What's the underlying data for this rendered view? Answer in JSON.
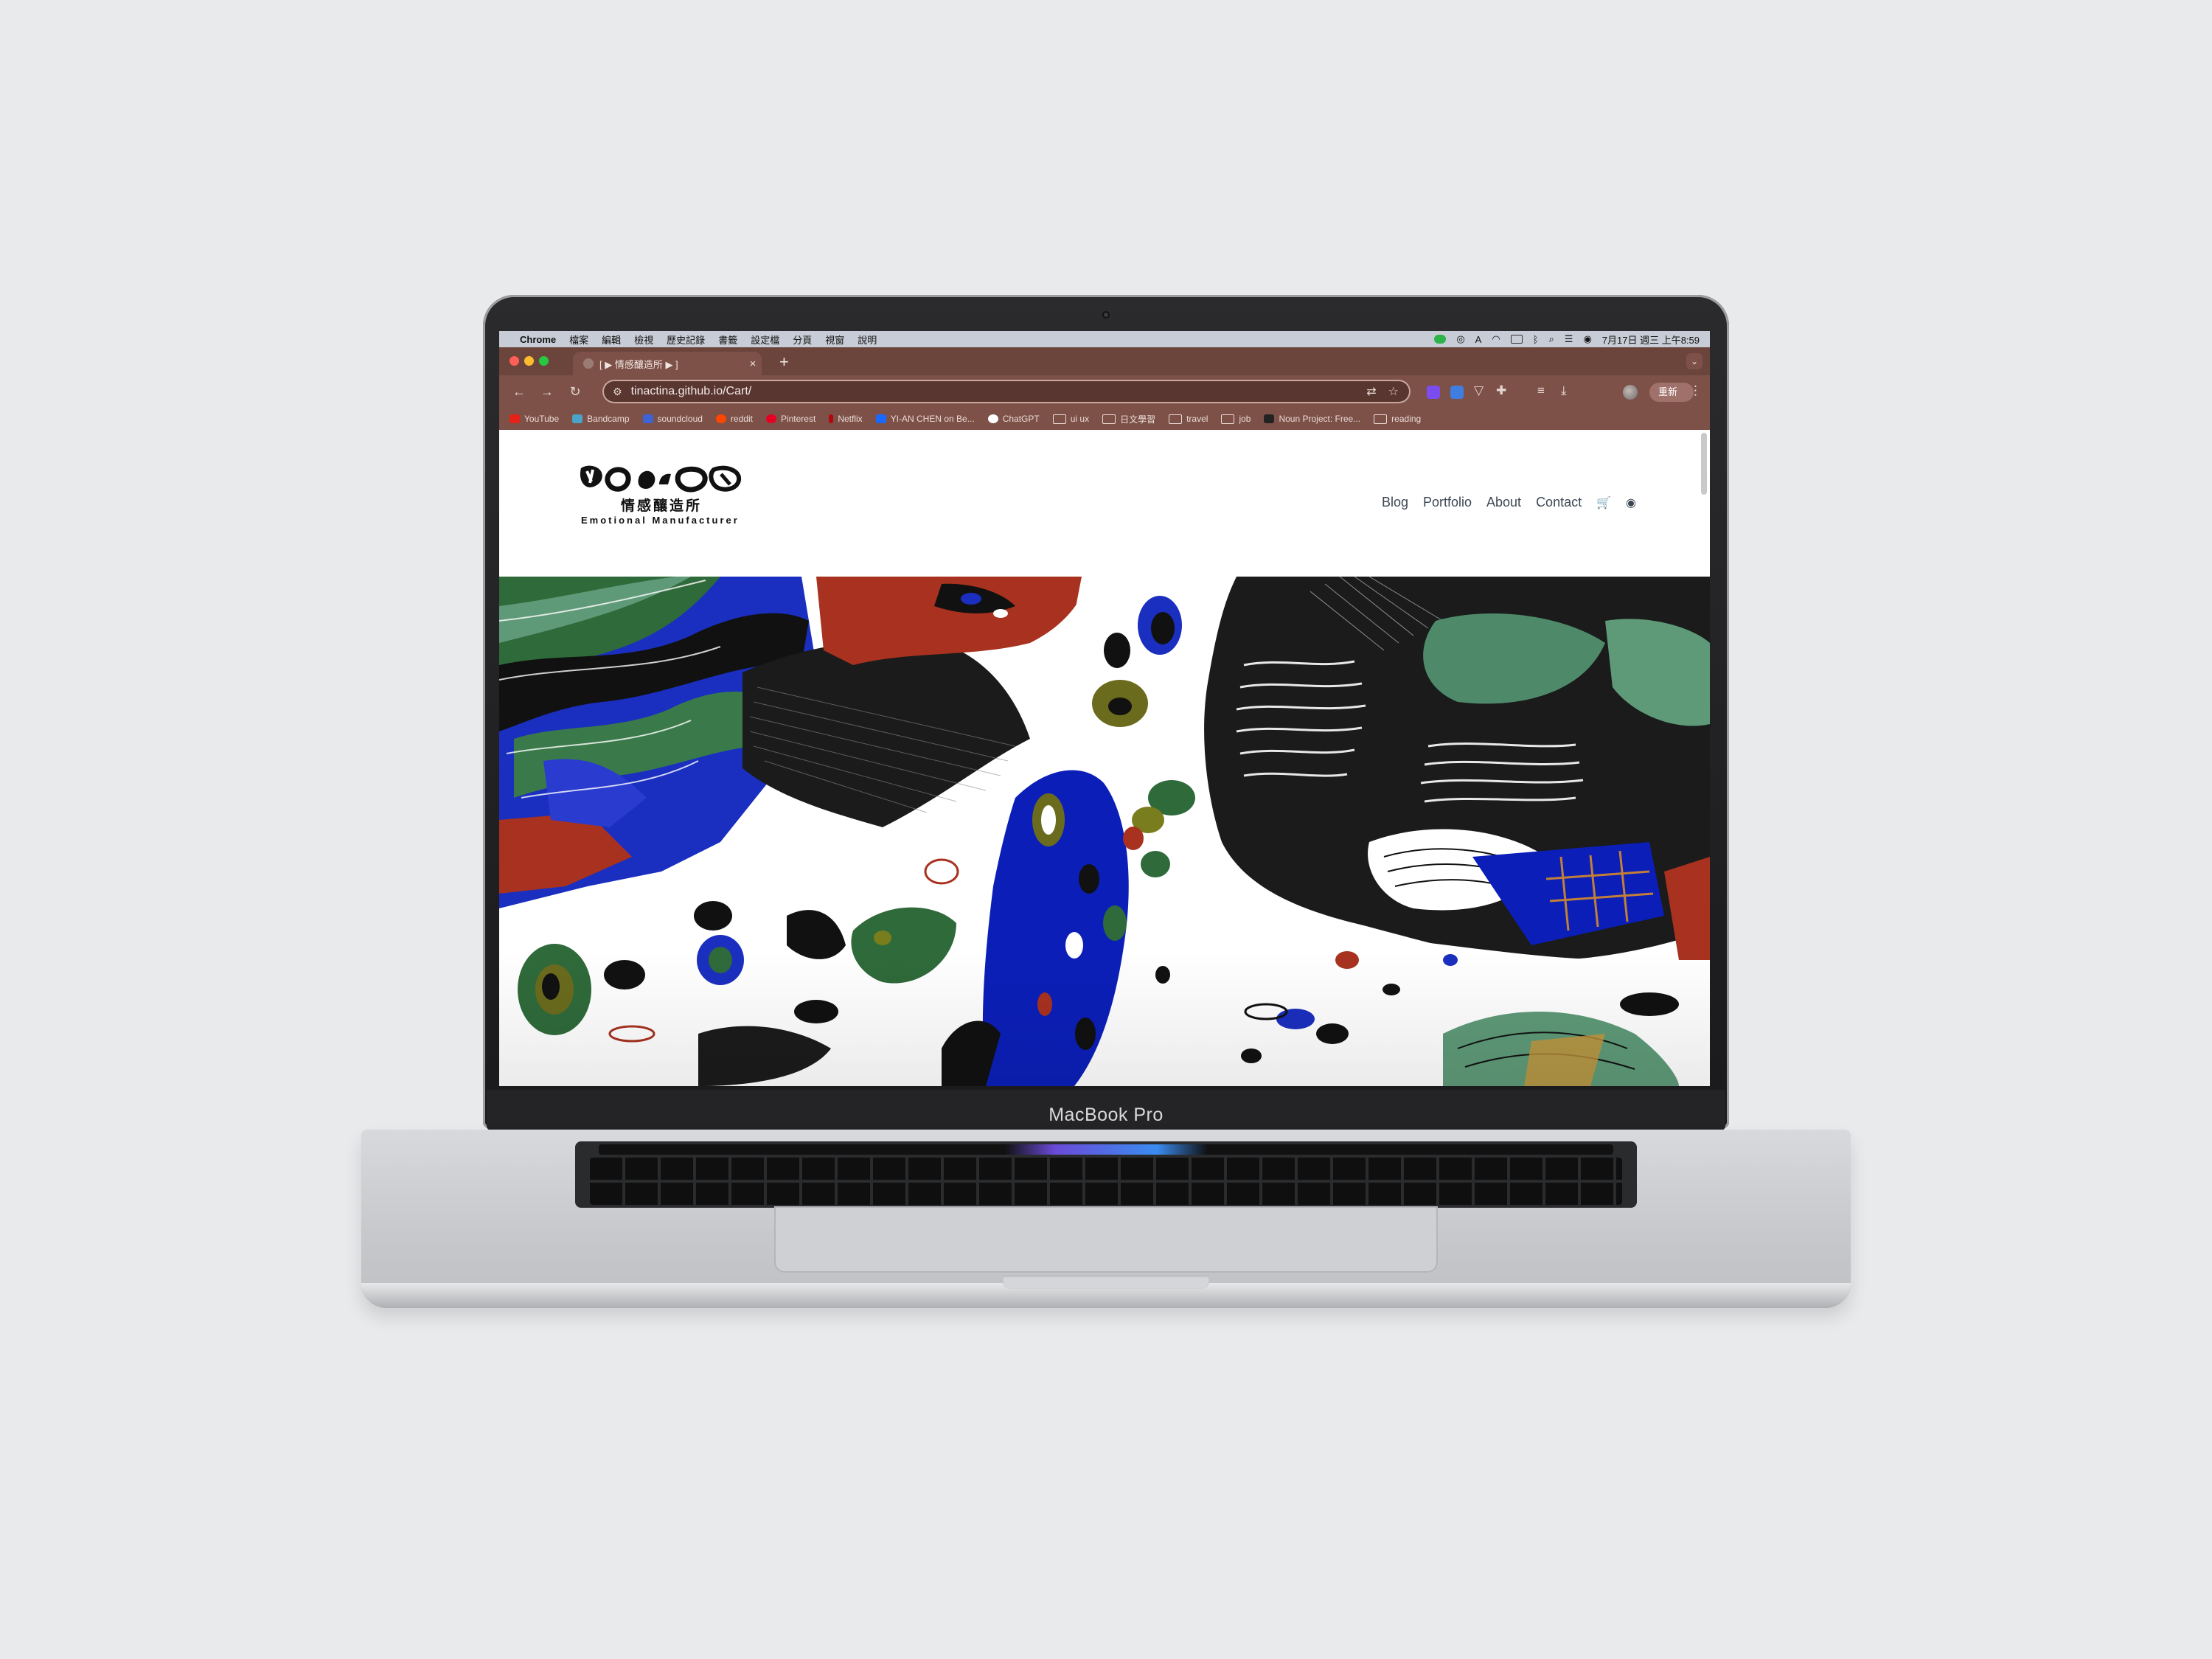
{
  "device": {
    "model_label": "MacBook Pro"
  },
  "menubar": {
    "app": "Chrome",
    "items": [
      "檔案",
      "編輯",
      "檢視",
      "歷史記錄",
      "書籤",
      "設定檔",
      "分頁",
      "視窗",
      "說明"
    ],
    "clock": "7月17日 週三 上午8:59"
  },
  "browser": {
    "tab_title": "[ ▶ 情感釀造所 ▶ ]",
    "tab_close": "×",
    "new_tab": "+",
    "url": "tinactina.github.io/Cart/",
    "relaunch_label": "重新",
    "colors": {
      "frame": "#6b443c",
      "toolbar": "#7d5148"
    },
    "bookmarks": [
      {
        "label": "YouTube",
        "icon": "youtube-icon",
        "color": "#e62117"
      },
      {
        "label": "Bandcamp",
        "icon": "bandcamp-icon",
        "color": "#4aa3c9"
      },
      {
        "label": "soundcloud",
        "icon": "soundcloud-icon",
        "color": "#3d63d6"
      },
      {
        "label": "reddit",
        "icon": "reddit-icon",
        "color": "#ff4500"
      },
      {
        "label": "Pinterest",
        "icon": "pinterest-icon",
        "color": "#e60023"
      },
      {
        "label": "Netflix",
        "icon": "netflix-icon",
        "color": "#b20710"
      },
      {
        "label": "YI-AN CHEN on Be...",
        "icon": "behance-icon",
        "color": "#1769ff"
      },
      {
        "label": "ChatGPT",
        "icon": "chatgpt-icon",
        "color": "#ffffff"
      },
      {
        "label": "ui ux",
        "icon": "folder-icon",
        "color": ""
      },
      {
        "label": "日文學習",
        "icon": "folder-icon",
        "color": ""
      },
      {
        "label": "travel",
        "icon": "folder-icon",
        "color": ""
      },
      {
        "label": "job",
        "icon": "folder-icon",
        "color": ""
      },
      {
        "label": "Noun Project: Free...",
        "icon": "noun-project-icon",
        "color": "#222222"
      },
      {
        "label": "reading",
        "icon": "folder-icon",
        "color": ""
      }
    ]
  },
  "site": {
    "logo_cn": "情感釀造所",
    "logo_en": "Emotional Manufacturer",
    "nav": [
      {
        "label": "Blog"
      },
      {
        "label": "Portfolio"
      },
      {
        "label": "About"
      },
      {
        "label": "Contact"
      }
    ],
    "hero_colors": [
      "#0b1fb8",
      "#2f6a3a",
      "#a8321f",
      "#5e9a78",
      "#7a7d1e",
      "#111111",
      "#ffffff"
    ]
  }
}
